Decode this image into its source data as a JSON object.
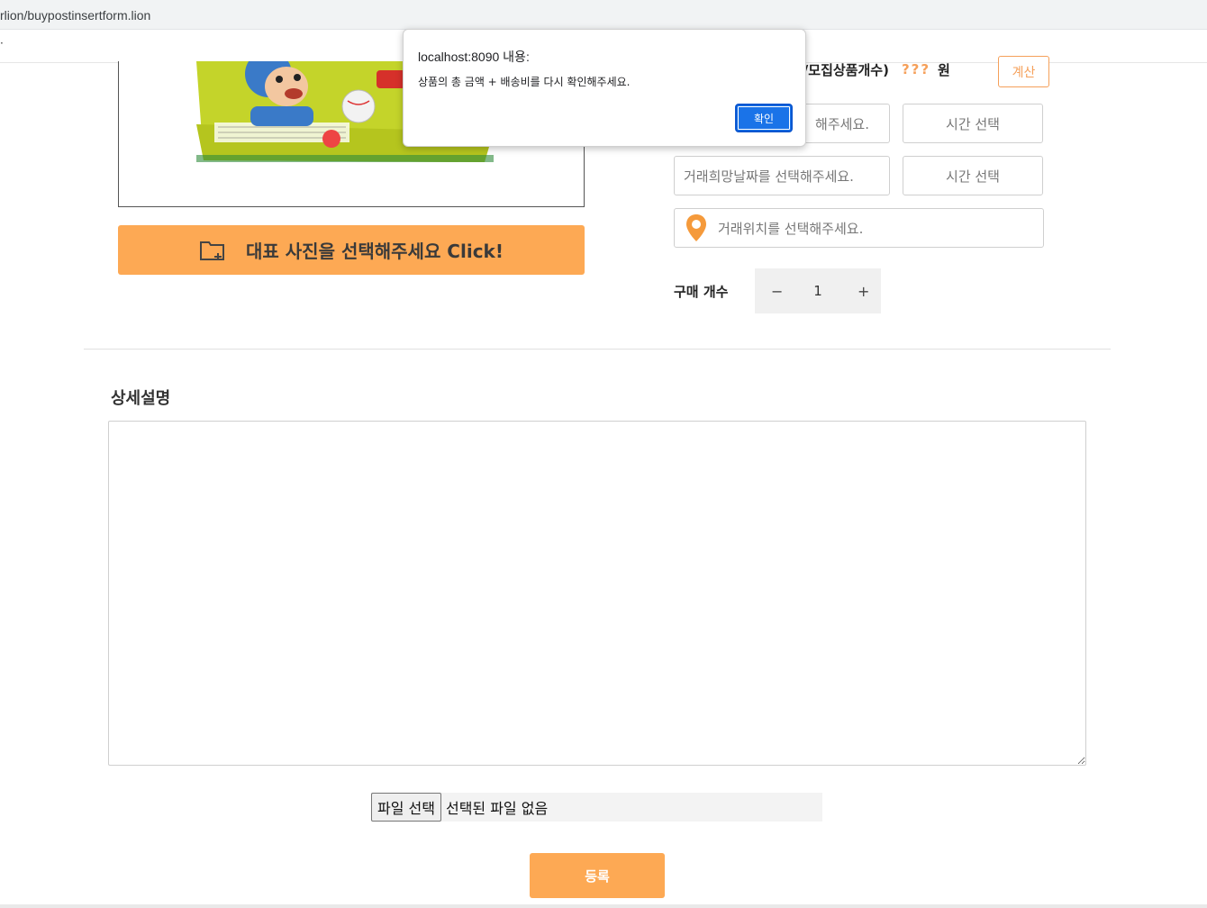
{
  "browser": {
    "url": "rlion/buypostinsertform.lion"
  },
  "photo_button": {
    "label": "대표 사진을 선택해주세요 Click!"
  },
  "price": {
    "label": "액/모집상품개수)",
    "value": "???",
    "unit": "원",
    "calc_button": "계산"
  },
  "trade": {
    "date_placeholder_1": "해주세요.",
    "time_button_1": "시간 선택",
    "date_placeholder_2": "거래희망날짜를 선택해주세요.",
    "time_button_2": "시간 선택",
    "location_placeholder": "거래위치를 선택해주세요."
  },
  "quantity": {
    "label": "구매 개수",
    "minus": "−",
    "value": "1",
    "plus": "+"
  },
  "detail": {
    "title": "상세설명",
    "text": ""
  },
  "file": {
    "button": "파일 선택",
    "status": "선택된 파일 없음"
  },
  "submit": {
    "label": "등록"
  },
  "dialog": {
    "title": "localhost:8090 내용:",
    "message": "상품의 총 금액 + 배송비를 다시 확인해주세요.",
    "ok": "확인"
  },
  "colors": {
    "accent": "#fda954",
    "accent_text": "#f5a05a",
    "dialog_button": "#1a73e8"
  }
}
